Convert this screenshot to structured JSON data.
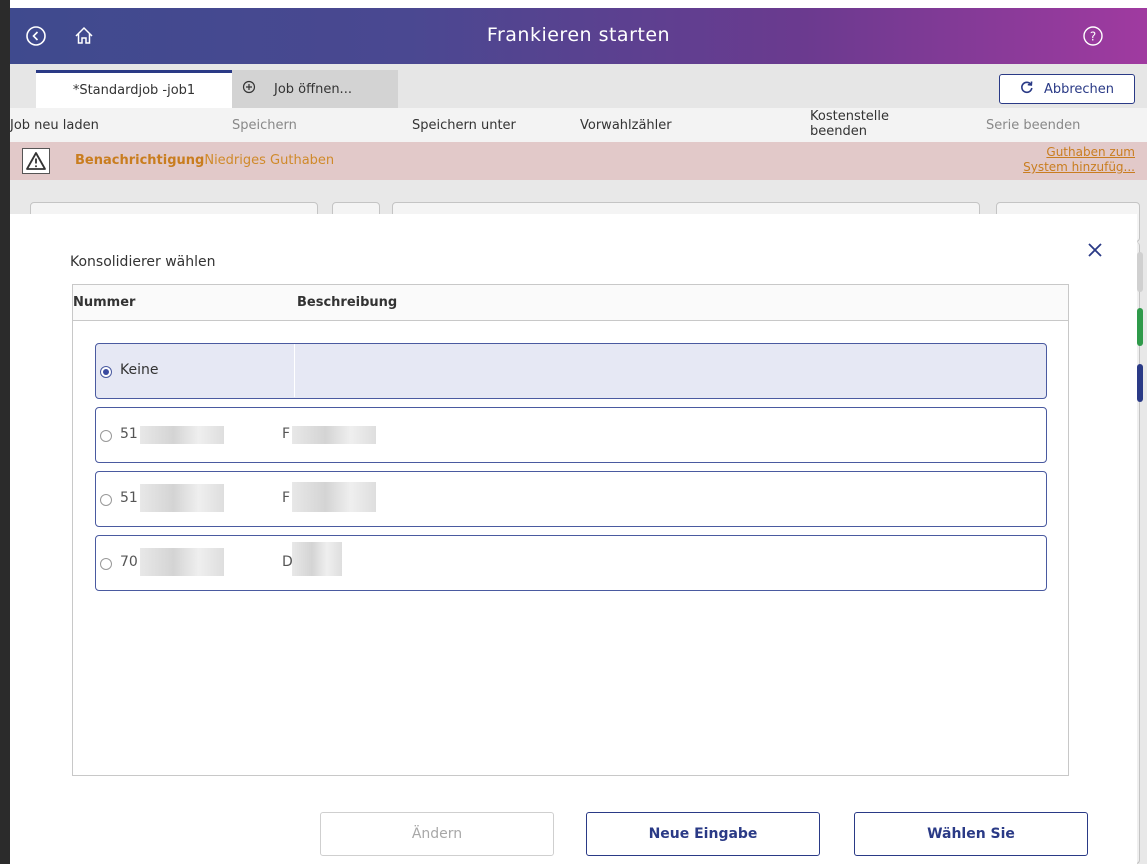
{
  "titlebar": {
    "title": "Frankieren starten",
    "back_icon": "back-circle-icon",
    "home_icon": "home-icon",
    "help_icon": "help-circle-icon"
  },
  "tabs": {
    "active_label": "*Standardjob -job1",
    "open_label": "Job öffnen...",
    "cancel_label": "Abbrechen"
  },
  "menu": {
    "reload": "Job neu laden",
    "save": "Speichern",
    "save_as": "Speichern unter",
    "preset_counter": "Vorwahlzähler",
    "end_cost_center_1": "Kostenstelle",
    "end_cost_center_2": "beenden",
    "end_series": "Serie beenden"
  },
  "notification": {
    "label": "Benachrichtigung",
    "message": "Niedriges Guthaben",
    "link_1": "Guthaben zum",
    "link_2": "System hinzufüg..."
  },
  "modal": {
    "title": "Konsolidierer wählen",
    "headers": {
      "number": "Nummer",
      "description": "Beschreibung"
    },
    "rows": [
      {
        "number": "Keine",
        "description": "",
        "selected": true
      },
      {
        "number": "51",
        "description": "F",
        "selected": false
      },
      {
        "number": "51",
        "description": "F",
        "selected": false
      },
      {
        "number": "70",
        "description": "D",
        "selected": false
      }
    ],
    "buttons": {
      "change": "Ändern",
      "new_entry": "Neue Eingabe",
      "choose": "Wählen Sie"
    }
  },
  "colors": {
    "accent": "#2a3a86",
    "warning": "#c97d1f",
    "notification_bg": "#e2c9c9"
  }
}
